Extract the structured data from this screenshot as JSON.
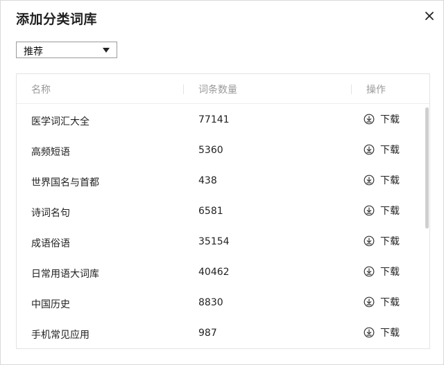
{
  "dialog": {
    "title": "添加分类词库",
    "close_icon": "close-icon"
  },
  "filter": {
    "selected": "推荐"
  },
  "table": {
    "headers": {
      "name": "名称",
      "count": "词条数量",
      "action": "操作"
    },
    "rows": [
      {
        "name": "医学词汇大全",
        "count": "77141",
        "action": "下载"
      },
      {
        "name": "高频短语",
        "count": "5360",
        "action": "下载"
      },
      {
        "name": "世界国名与首都",
        "count": "438",
        "action": "下载"
      },
      {
        "name": "诗词名句",
        "count": "6581",
        "action": "下载"
      },
      {
        "name": "成语俗语",
        "count": "35154",
        "action": "下载"
      },
      {
        "name": "日常用语大词库",
        "count": "40462",
        "action": "下载"
      },
      {
        "name": "中国历史",
        "count": "8830",
        "action": "下载"
      },
      {
        "name": "手机常见应用",
        "count": "987",
        "action": "下载"
      }
    ],
    "download_icon": "download-circle-icon"
  },
  "colors": {
    "header_text": "#9a9a9a",
    "body_text": "#222222",
    "border": "#e3e3e3"
  }
}
